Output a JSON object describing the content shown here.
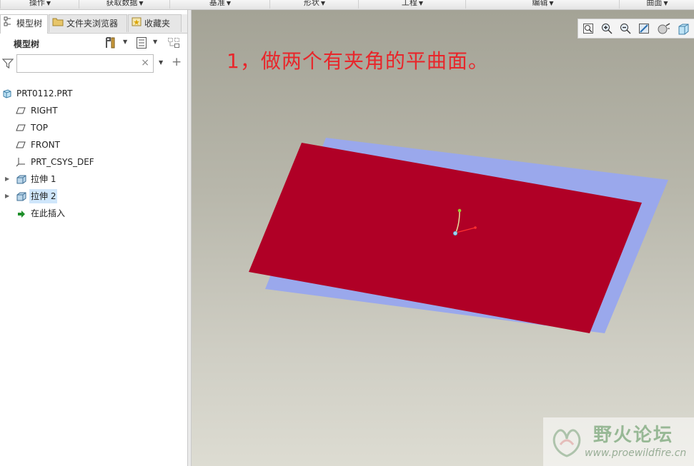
{
  "ribbon": {
    "groups": [
      {
        "label": "操作"
      },
      {
        "label": "获取数据"
      },
      {
        "label": "基准"
      },
      {
        "label": "形状"
      },
      {
        "label": "工程"
      },
      {
        "label": "编辑"
      },
      {
        "label": "曲面"
      }
    ]
  },
  "left_panel": {
    "tabs": [
      {
        "label": "模型树",
        "active": true
      },
      {
        "label": "文件夹浏览器",
        "active": false
      },
      {
        "label": "收藏夹",
        "active": false
      }
    ],
    "tree_title": "模型树",
    "filter": {
      "value": "",
      "placeholder": ""
    },
    "tree": [
      {
        "label": "PRT0112.PRT",
        "icon": "part-icon"
      },
      {
        "label": "RIGHT",
        "icon": "datum-plane-icon"
      },
      {
        "label": "TOP",
        "icon": "datum-plane-icon"
      },
      {
        "label": "FRONT",
        "icon": "datum-plane-icon"
      },
      {
        "label": "PRT_CSYS_DEF",
        "icon": "csys-icon"
      },
      {
        "label": "拉伸 1",
        "icon": "extrude-icon",
        "expandable": true
      },
      {
        "label": "拉伸 2",
        "icon": "extrude-icon",
        "expandable": true,
        "selected": true
      },
      {
        "label": "在此插入",
        "icon": "insert-arrow-icon"
      }
    ]
  },
  "viewport": {
    "annotation": "1，做两个有夹角的平曲面。",
    "surface_colors": {
      "front_surface": "#b00026",
      "back_surface": "#9aa8ec"
    },
    "background_top": "#a4a396",
    "background_bottom": "#dddcd2"
  },
  "watermark": {
    "title": "野火论坛",
    "url": "www.proewildfire.cn"
  }
}
